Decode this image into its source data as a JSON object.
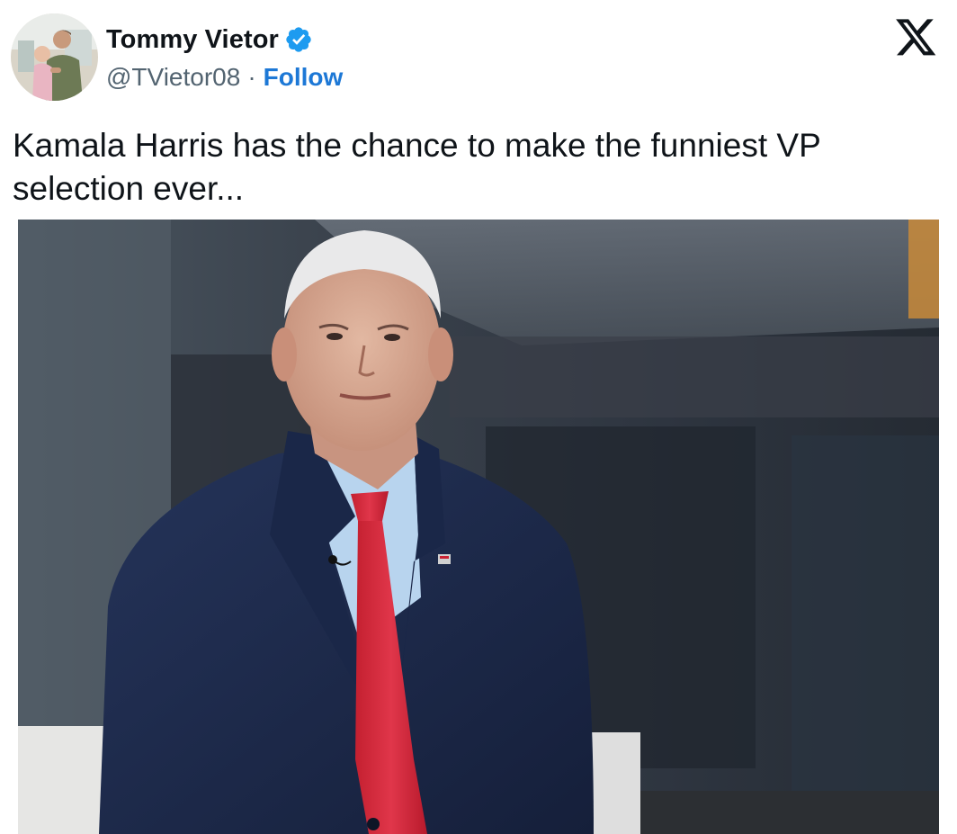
{
  "author": {
    "display_name": "Tommy Vietor",
    "handle": "@TVietor08",
    "separator": "·",
    "follow_label": "Follow",
    "verified": true,
    "avatar_icon": "avatar-photo",
    "verified_icon": "verified-badge-icon"
  },
  "platform": {
    "logo_icon": "x-logo-icon"
  },
  "tweet": {
    "text": "Kamala Harris has the chance to make the funniest VP selection ever..."
  },
  "colors": {
    "follow": "#1d78d6",
    "verified_badge": "#1d9bf0",
    "handle": "#536471",
    "text": "#0f1419"
  }
}
